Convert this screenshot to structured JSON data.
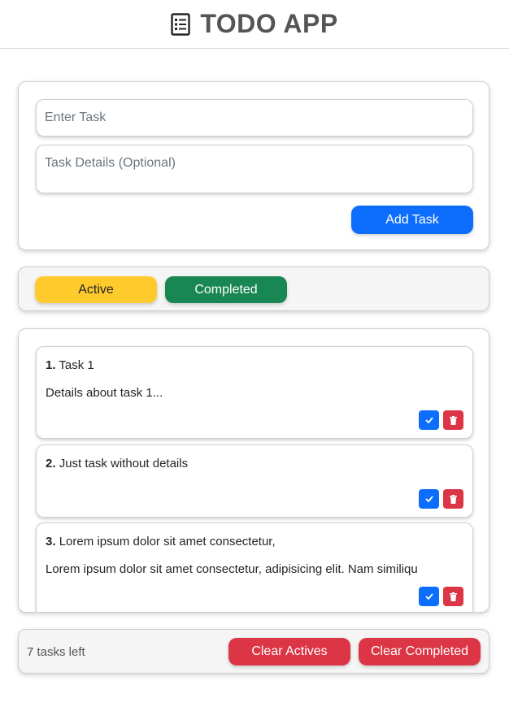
{
  "header": {
    "title": "TODO APP",
    "icon": "list-icon"
  },
  "form": {
    "task_placeholder": "Enter Task",
    "task_value": "",
    "details_placeholder": "Task Details (Optional)",
    "details_value": "",
    "add_label": "Add Task"
  },
  "filters": {
    "active_label": "Active",
    "completed_label": "Completed"
  },
  "tasks": [
    {
      "number": "1.",
      "title": "Task 1",
      "details": "Details about task 1..."
    },
    {
      "number": "2.",
      "title": "Just task without details",
      "details": ""
    },
    {
      "number": "3.",
      "title": "Lorem ipsum dolor sit amet consectetur,",
      "details": "Lorem ipsum dolor sit amet consectetur, adipisicing elit. Nam similiqu"
    }
  ],
  "footer": {
    "tasks_left": "7 tasks left",
    "clear_actives_label": "Clear Actives",
    "clear_completed_label": "Clear Completed"
  },
  "colors": {
    "primary": "#0d6efd",
    "danger": "#dc3545",
    "warning": "#ffca2c",
    "success": "#198754"
  }
}
